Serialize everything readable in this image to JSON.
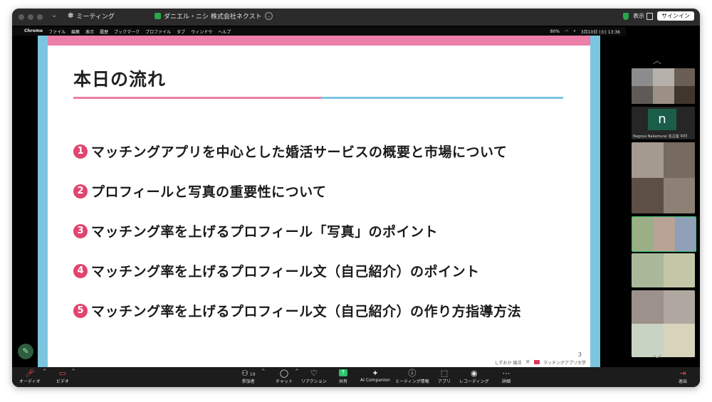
{
  "titlebar": {
    "app_name": "ミーティング",
    "share_label": "ダニエル・ニシ 株式会社ネクスト",
    "view_label": "表示",
    "signin_label": "サインイン"
  },
  "mac_menubar": {
    "app": "Chrome",
    "menus": [
      "ファイル",
      "編集",
      "表示",
      "履歴",
      "ブックマーク",
      "プロファイル",
      "タブ",
      "ウィンドウ",
      "ヘルプ"
    ],
    "battery": "80%",
    "datetime": "3月10日 (火) 13:36"
  },
  "slide": {
    "title": "本日の流れ",
    "items": [
      {
        "num": "1",
        "text": "マッチングアプリを中心とした婚活サービスの概要と市場について"
      },
      {
        "num": "2",
        "text": "プロフィールと写真の重要性について"
      },
      {
        "num": "3",
        "text": "マッチング率を上げるプロフィール「写真」のポイント"
      },
      {
        "num": "4",
        "text": "マッチング率を上げるプロフィール文（自己紹介）のポイント"
      },
      {
        "num": "5",
        "text": "マッチング率を上げるプロフィール文（自己紹介）の作り方指導方法"
      }
    ],
    "page_number": "3",
    "logo_left": "しずおか 婚活",
    "logo_cross": "×",
    "logo_right": "マッチングアプリ大学"
  },
  "gallery": {
    "n_avatar": "n",
    "n_label": "Nagoya Nakamura/ 名古屋 中村"
  },
  "toolbar": {
    "audio": "オーディオ",
    "video": "ビデオ",
    "participants": "参加者",
    "participant_count": "19",
    "chat": "チャット",
    "reactions": "リアクション",
    "share": "共有",
    "ai": "AI Companion",
    "info": "ミーティング情報",
    "apps": "アプリ",
    "record": "レコーディング",
    "more": "詳細",
    "leave": "退出"
  }
}
